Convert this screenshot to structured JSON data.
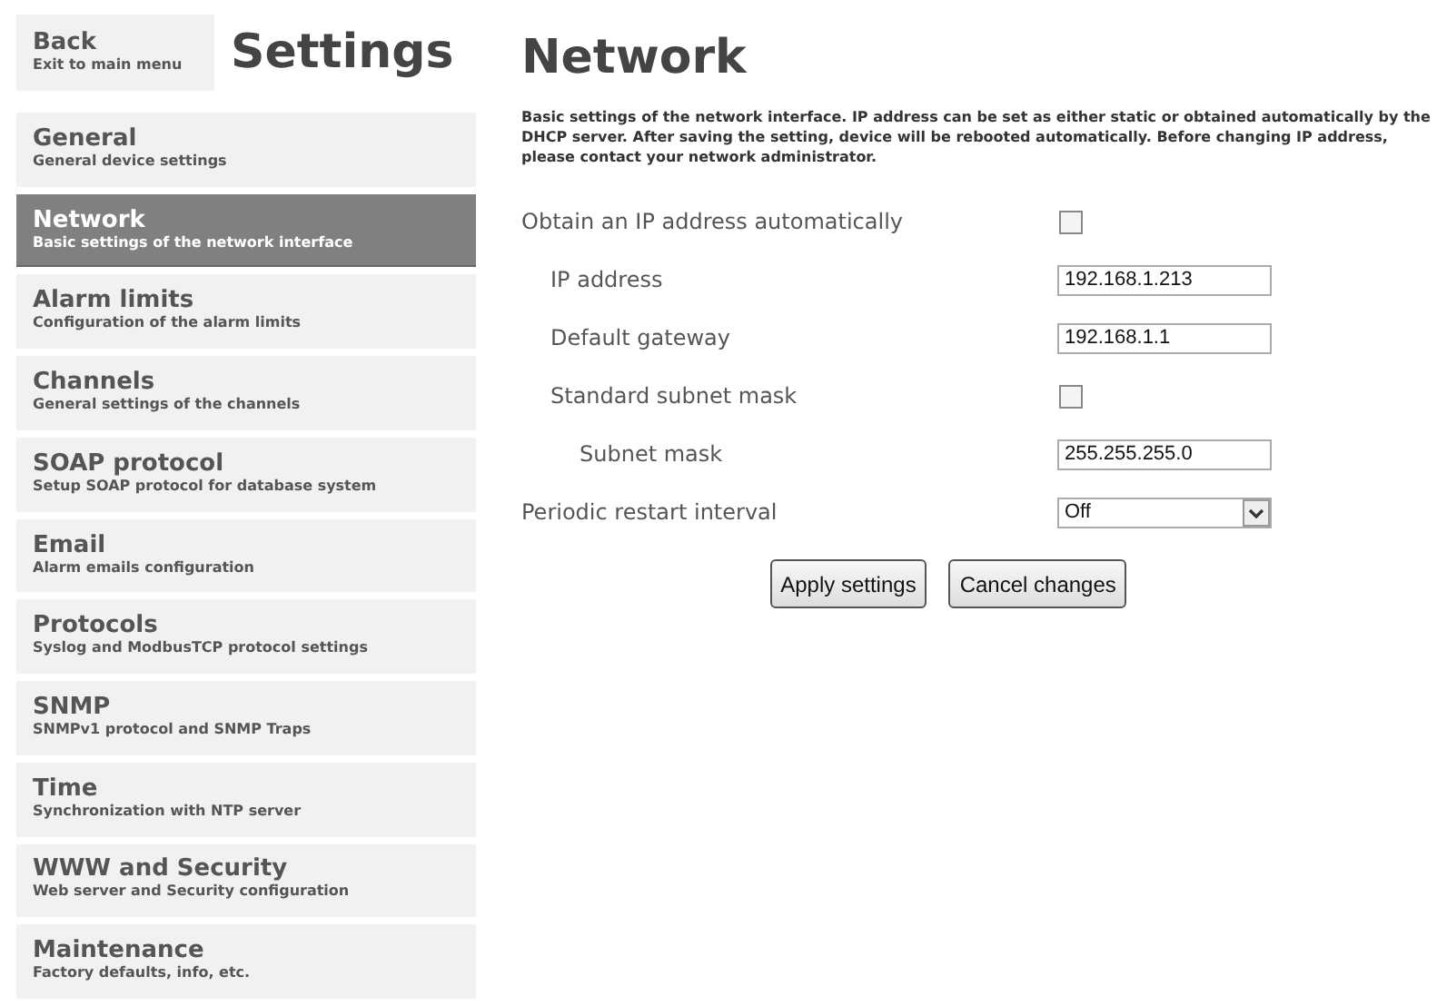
{
  "back": {
    "title": "Back",
    "subtitle": "Exit to main menu"
  },
  "header": {
    "title": "Settings"
  },
  "sidebar": {
    "items": [
      {
        "title": "General",
        "subtitle": "General device settings",
        "selected": false
      },
      {
        "title": "Network",
        "subtitle": "Basic settings of the network interface",
        "selected": true
      },
      {
        "title": "Alarm limits",
        "subtitle": "Configuration of the alarm limits",
        "selected": false
      },
      {
        "title": "Channels",
        "subtitle": "General settings of the channels",
        "selected": false
      },
      {
        "title": "SOAP protocol",
        "subtitle": "Setup SOAP protocol for database system",
        "selected": false
      },
      {
        "title": "Email",
        "subtitle": "Alarm emails configuration",
        "selected": false
      },
      {
        "title": "Protocols",
        "subtitle": "Syslog and ModbusTCP protocol settings",
        "selected": false
      },
      {
        "title": "SNMP",
        "subtitle": "SNMPv1 protocol and SNMP Traps",
        "selected": false
      },
      {
        "title": "Time",
        "subtitle": "Synchronization with NTP server",
        "selected": false
      },
      {
        "title": "WWW and Security",
        "subtitle": "Web server and Security configuration",
        "selected": false
      },
      {
        "title": "Maintenance",
        "subtitle": "Factory defaults, info, etc.",
        "selected": false
      }
    ]
  },
  "page": {
    "title": "Network",
    "description": "Basic settings of the network interface. IP address can be set as either static or obtained automatically by the DHCP server. After saving the setting, device will be rebooted automatically. Before changing IP address, please contact your network administrator."
  },
  "form": [
    {
      "label": "Obtain an IP address automatically",
      "kind": "checkbox",
      "checked": false,
      "children": [
        {
          "label": "IP address",
          "kind": "text",
          "value": "192.168.1.213"
        },
        {
          "label": "Default gateway",
          "kind": "text",
          "value": "192.168.1.1"
        },
        {
          "label": "Standard subnet mask",
          "kind": "checkbox",
          "checked": false,
          "children": [
            {
              "label": "Subnet mask",
              "kind": "text",
              "value": "255.255.255.0"
            }
          ]
        }
      ]
    },
    {
      "label": "Periodic restart interval",
      "kind": "select",
      "value": "Off"
    }
  ],
  "buttons": [
    "Apply settings",
    "Cancel changes"
  ]
}
